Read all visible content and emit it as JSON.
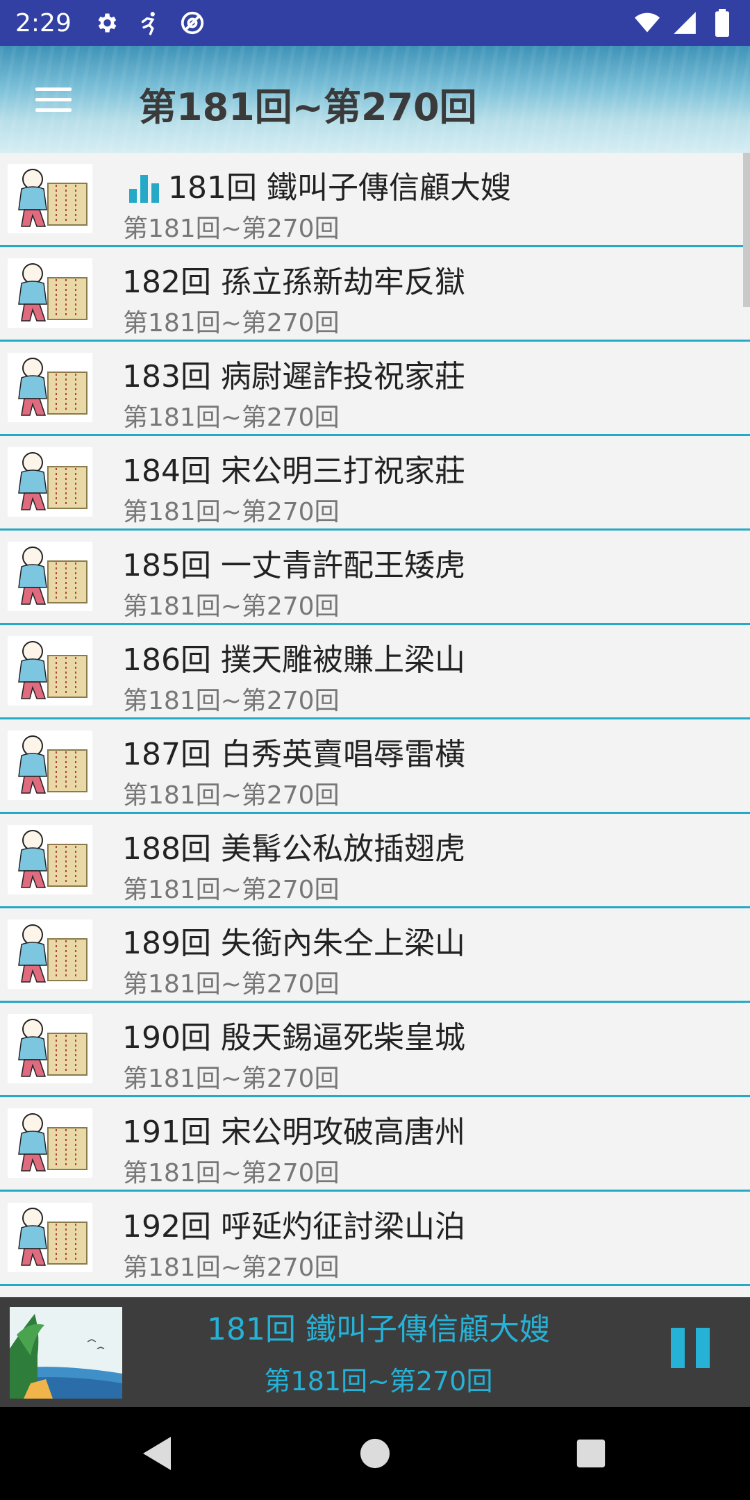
{
  "status_bar": {
    "time": "2:29",
    "icons_left": [
      "gear-icon",
      "runner-icon",
      "at-sign-icon"
    ],
    "icons_right": [
      "wifi-icon",
      "signal-icon",
      "battery-icon"
    ]
  },
  "app_bar": {
    "title": "第181回~第270回",
    "menu_icon": "hamburger-icon"
  },
  "episodes": [
    {
      "title": "181回 鐵叫子傳信顧大嫂",
      "subtitle": "第181回~第270回",
      "playing": true
    },
    {
      "title": "182回 孫立孫新劫牢反獄",
      "subtitle": "第181回~第270回"
    },
    {
      "title": "183回 病尉遲詐投祝家莊",
      "subtitle": "第181回~第270回"
    },
    {
      "title": "184回 宋公明三打祝家莊",
      "subtitle": "第181回~第270回"
    },
    {
      "title": "185回 一丈青許配王矮虎",
      "subtitle": "第181回~第270回"
    },
    {
      "title": "186回 撲天雕被賺上梁山",
      "subtitle": "第181回~第270回"
    },
    {
      "title": "187回 白秀英賣唱辱雷橫",
      "subtitle": "第181回~第270回"
    },
    {
      "title": "188回 美髯公私放插翅虎",
      "subtitle": "第181回~第270回"
    },
    {
      "title": "189回 失銜內朱仝上梁山",
      "subtitle": "第181回~第270回"
    },
    {
      "title": "190回 殷天錫逼死柴皇城",
      "subtitle": "第181回~第270回"
    },
    {
      "title": "191回 宋公明攻破高唐州",
      "subtitle": "第181回~第270回"
    },
    {
      "title": "192回 呼延灼征討梁山泊",
      "subtitle": "第181回~第270回"
    }
  ],
  "player": {
    "title": "181回 鐵叫子傳信顧大嫂",
    "subtitle": "第181回~第270回",
    "state_icon": "pause-icon"
  },
  "navigation": [
    "back-icon",
    "home-icon",
    "recents-icon"
  ],
  "colors": {
    "status_bar": "#3140a2",
    "accent": "#26b1d6",
    "divider": "#26a9c7",
    "player_bg": "#3d3d3d"
  }
}
